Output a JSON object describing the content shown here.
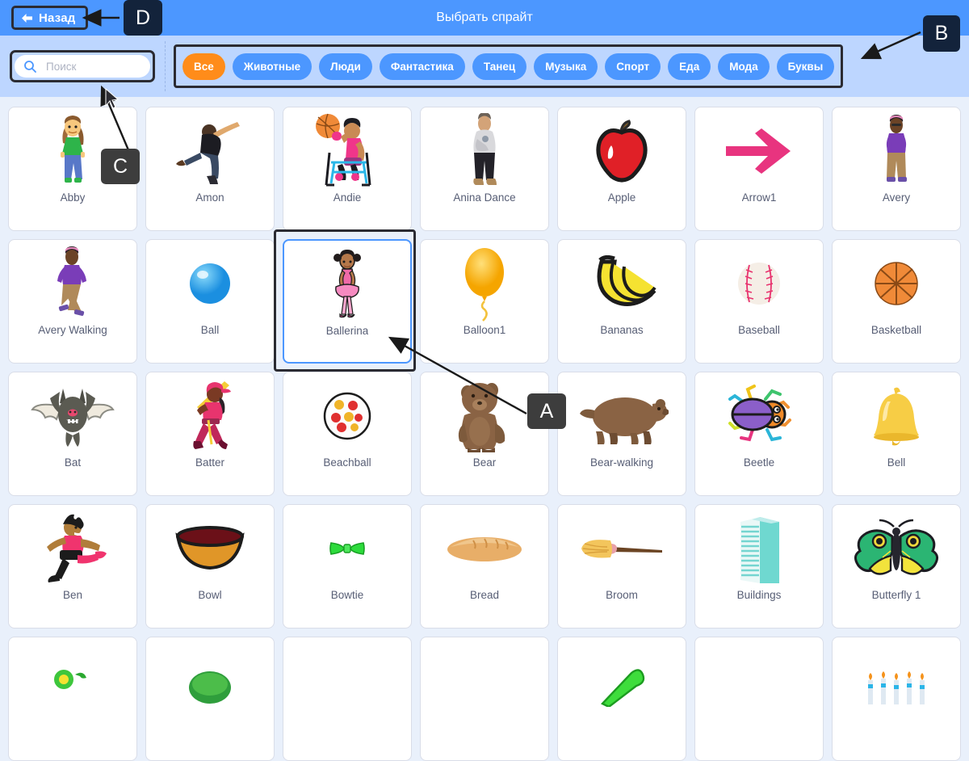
{
  "header": {
    "back_label": "Назад",
    "back_icon": "arrow-left-icon",
    "title": "Выбрать спрайт"
  },
  "search": {
    "icon": "search-icon",
    "placeholder": "Поиск",
    "value": ""
  },
  "tabs": [
    {
      "label": "Все",
      "active": true
    },
    {
      "label": "Животные",
      "active": false
    },
    {
      "label": "Люди",
      "active": false
    },
    {
      "label": "Фантастика",
      "active": false
    },
    {
      "label": "Танец",
      "active": false
    },
    {
      "label": "Музыка",
      "active": false
    },
    {
      "label": "Спорт",
      "active": false
    },
    {
      "label": "Еда",
      "active": false
    },
    {
      "label": "Мода",
      "active": false
    },
    {
      "label": "Буквы",
      "active": false
    }
  ],
  "sprites": [
    {
      "name": "Abby",
      "icon": "girl-standing-sprite",
      "hovered": false
    },
    {
      "name": "Amon",
      "icon": "man-dancing-sprite",
      "hovered": false
    },
    {
      "name": "Andie",
      "icon": "wheelchair-basketball-sprite",
      "hovered": false
    },
    {
      "name": "Anina Dance",
      "icon": "person-hoodie-sprite",
      "hovered": false
    },
    {
      "name": "Apple",
      "icon": "apple-sprite",
      "hovered": false
    },
    {
      "name": "Arrow1",
      "icon": "arrow-right-sprite",
      "hovered": false
    },
    {
      "name": "Avery",
      "icon": "girl-purple-shirt-sprite",
      "hovered": false
    },
    {
      "name": "Avery Walking",
      "icon": "girl-walking-sprite",
      "hovered": false
    },
    {
      "name": "Ball",
      "icon": "ball-sprite",
      "hovered": false
    },
    {
      "name": "Ballerina",
      "icon": "ballerina-sprite",
      "hovered": true
    },
    {
      "name": "Balloon1",
      "icon": "balloon-sprite",
      "hovered": false
    },
    {
      "name": "Bananas",
      "icon": "bananas-sprite",
      "hovered": false
    },
    {
      "name": "Baseball",
      "icon": "baseball-sprite",
      "hovered": false
    },
    {
      "name": "Basketball",
      "icon": "basketball-sprite",
      "hovered": false
    },
    {
      "name": "Bat",
      "icon": "bat-sprite",
      "hovered": false
    },
    {
      "name": "Batter",
      "icon": "batter-sprite",
      "hovered": false
    },
    {
      "name": "Beachball",
      "icon": "beachball-sprite",
      "hovered": false
    },
    {
      "name": "Bear",
      "icon": "bear-sprite",
      "hovered": false
    },
    {
      "name": "Bear-walking",
      "icon": "bear-walking-sprite",
      "hovered": false
    },
    {
      "name": "Beetle",
      "icon": "beetle-sprite",
      "hovered": false
    },
    {
      "name": "Bell",
      "icon": "bell-sprite",
      "hovered": false
    },
    {
      "name": "Ben",
      "icon": "boy-kicking-sprite",
      "hovered": false
    },
    {
      "name": "Bowl",
      "icon": "bowl-sprite",
      "hovered": false
    },
    {
      "name": "Bowtie",
      "icon": "bowtie-sprite",
      "hovered": false
    },
    {
      "name": "Bread",
      "icon": "bread-sprite",
      "hovered": false
    },
    {
      "name": "Broom",
      "icon": "broom-sprite",
      "hovered": false
    },
    {
      "name": "Buildings",
      "icon": "buildings-sprite",
      "hovered": false
    },
    {
      "name": "Butterfly 1",
      "icon": "butterfly-sprite",
      "hovered": false
    }
  ],
  "partial_row": [
    {
      "icon": "cake-sprite"
    },
    {
      "icon": "calvrett-sprite"
    },
    {
      "icon": "blank-sprite"
    },
    {
      "icon": "blank-sprite"
    },
    {
      "icon": "green-bean-sprite"
    },
    {
      "icon": "blank-sprite"
    },
    {
      "icon": "candles-sprite"
    }
  ],
  "annotations": [
    {
      "id": "A",
      "label": "A"
    },
    {
      "id": "B",
      "label": "B"
    },
    {
      "id": "C",
      "label": "C"
    },
    {
      "id": "D",
      "label": "D"
    }
  ],
  "colors": {
    "header_blue": "#4c97ff",
    "filter_blue": "#bdd6ff",
    "page_bg": "#e9f0fb",
    "accent_orange": "#ff8c1a",
    "label_text": "#575e75",
    "annotation_dark": "#13233b",
    "annotation_gray": "#3d3d3d"
  }
}
